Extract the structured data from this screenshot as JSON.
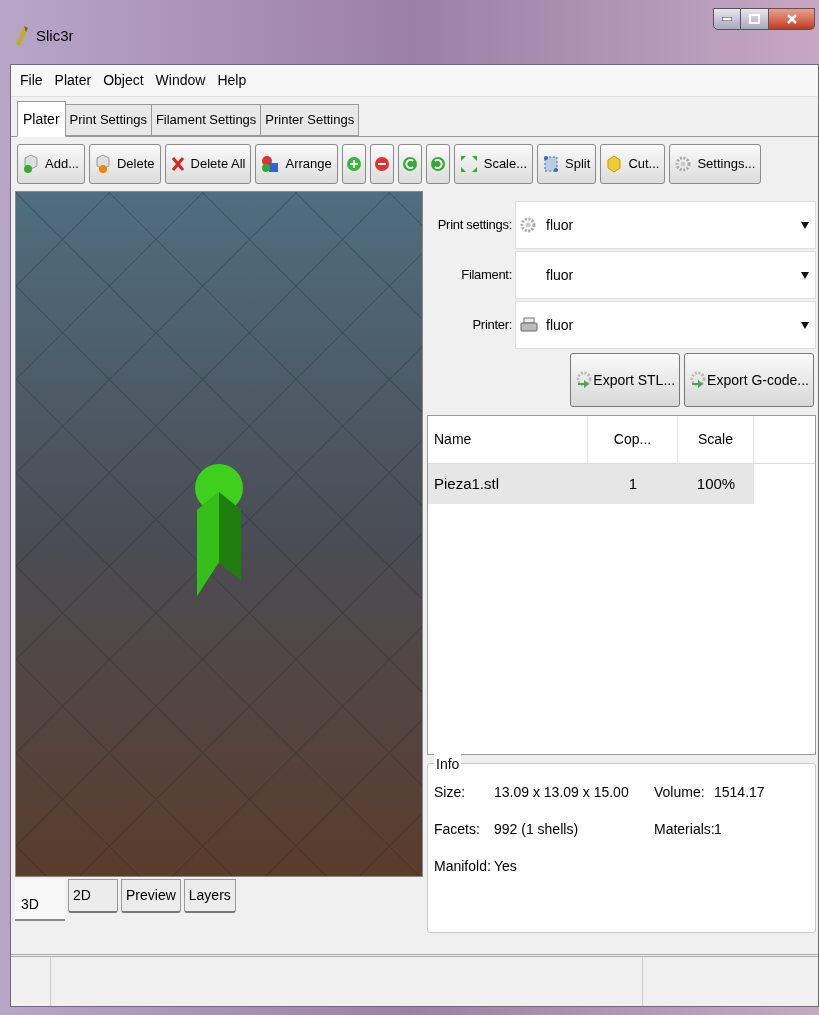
{
  "window": {
    "title": "Slic3r"
  },
  "menu": [
    "File",
    "Plater",
    "Object",
    "Window",
    "Help"
  ],
  "tabs": [
    {
      "label": "Plater",
      "selected": true
    },
    {
      "label": "Print Settings",
      "selected": false
    },
    {
      "label": "Filament Settings",
      "selected": false
    },
    {
      "label": "Printer Settings",
      "selected": false
    }
  ],
  "toolbar": [
    {
      "kind": "text",
      "label": "Add..."
    },
    {
      "kind": "text",
      "label": "Delete"
    },
    {
      "kind": "text",
      "label": "Delete All"
    },
    {
      "kind": "text",
      "label": "Arrange"
    },
    {
      "kind": "icon"
    },
    {
      "kind": "icon"
    },
    {
      "kind": "icon"
    },
    {
      "kind": "icon"
    },
    {
      "kind": "text",
      "label": "Scale..."
    },
    {
      "kind": "text",
      "label": "Split"
    },
    {
      "kind": "text",
      "label": "Cut..."
    },
    {
      "kind": "text",
      "label": "Settings..."
    }
  ],
  "presets": [
    {
      "label": "Print settings:",
      "value": "fluor"
    },
    {
      "label": "Filament:",
      "value": "fluor"
    },
    {
      "label": "Printer:",
      "value": "fluor"
    }
  ],
  "export_buttons": [
    "Export STL...",
    "Export G-code..."
  ],
  "objects_table": {
    "columns": [
      "Name",
      "Cop...",
      "Scale"
    ],
    "rows": [
      {
        "cells": [
          "Pieza1.stl",
          "1",
          "100%"
        ],
        "selected": true
      }
    ]
  },
  "info": {
    "title": "Info",
    "fields": [
      {
        "label": "Size:",
        "value": "13.09 x 13.09 x 15.00"
      },
      {
        "label": "Volume:",
        "value": "1514.17"
      },
      {
        "label": "Facets:",
        "value": "992 (1 shells)"
      },
      {
        "label": "Materials:",
        "value": "1"
      },
      {
        "label": "Manifold:",
        "value": "Yes"
      }
    ]
  },
  "view_tabs": [
    {
      "label": "3D",
      "selected": true
    },
    {
      "label": "2D",
      "selected": false
    },
    {
      "label": "Preview",
      "selected": false
    },
    {
      "label": "Layers",
      "selected": false
    }
  ]
}
